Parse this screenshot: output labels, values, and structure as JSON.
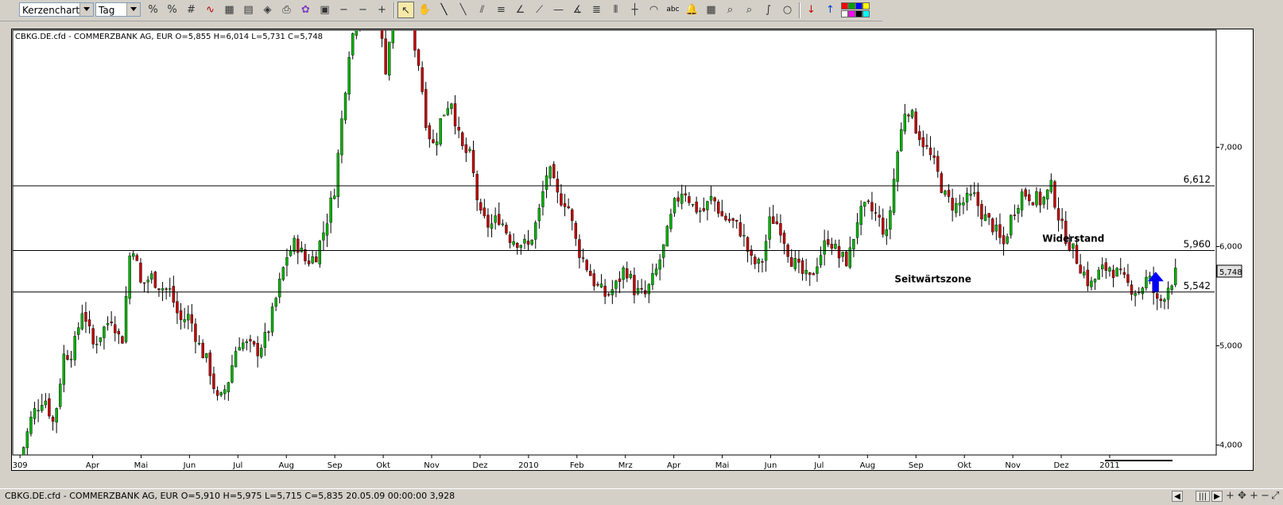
{
  "toolbar": {
    "chart_type_select": "Kerzenchart",
    "period_select": "Tag",
    "tools": [
      "percent-icon",
      "percent-alt-icon",
      "hash-icon",
      "indicator-icon",
      "calculator-sheet-icon",
      "chart-window-icon",
      "eraser-icon",
      "print-icon",
      "palette-icon",
      "bookmark-icon",
      "move-icon",
      "zoom-out-icon",
      "zoom-in-icon",
      "pointer-icon",
      "hand-icon",
      "line-icon",
      "line-angle-icon",
      "parallel-lines-icon",
      "fibonacci-icon",
      "fan-icon",
      "fan-alt-icon",
      "horizontal-line-icon",
      "fan-angle-icon",
      "color-bars-icon",
      "vertical-lines-icon",
      "crosshair-icon",
      "arc-icon",
      "text-icon",
      "alarm-bell-icon",
      "calculator-icon",
      "magnifier-icon",
      "magnifier-zoom-icon",
      "curve-icon",
      "circle-icon",
      "red-arrow-down-icon",
      "blue-arrow-up-icon",
      "color-palette-icon"
    ]
  },
  "chart_data": {
    "type": "candlestick",
    "title": "CBKG.DE.cfd - COMMERZBANK AG, EUR O=5,855 H=6,014 L=5,731 C=5,748",
    "y_axis_labels": [
      "7,000",
      "6,000",
      "5,000",
      "4,000"
    ],
    "y_ticks": [
      7.0,
      6.0,
      5.0,
      4.0
    ],
    "ylim": [
      3.9,
      8.18
    ],
    "x_ticks": [
      {
        "label": "309",
        "x": 0.5
      },
      {
        "label": "Apr",
        "x": 2
      },
      {
        "label": "Mai",
        "x": 3
      },
      {
        "label": "Jun",
        "x": 4
      },
      {
        "label": "Jul",
        "x": 5
      },
      {
        "label": "Aug",
        "x": 6
      },
      {
        "label": "Sep",
        "x": 7
      },
      {
        "label": "Okt",
        "x": 8
      },
      {
        "label": "Nov",
        "x": 9
      },
      {
        "label": "Dez",
        "x": 10
      },
      {
        "label": "2010",
        "x": 11
      },
      {
        "label": "Feb",
        "x": 12
      },
      {
        "label": "Mrz",
        "x": 13
      },
      {
        "label": "Apr",
        "x": 14
      },
      {
        "label": "Mai",
        "x": 15
      },
      {
        "label": "Jun",
        "x": 16
      },
      {
        "label": "Jul",
        "x": 17
      },
      {
        "label": "Aug",
        "x": 18
      },
      {
        "label": "Sep",
        "x": 19
      },
      {
        "label": "Okt",
        "x": 20
      },
      {
        "label": "Nov",
        "x": 21
      },
      {
        "label": "Dez",
        "x": 22
      },
      {
        "label": "2011",
        "x": 23
      }
    ],
    "x_range": [
      0.35,
      25.2
    ],
    "horizontal_lines": [
      {
        "value": 6.612,
        "label": "6,612"
      },
      {
        "value": 5.96,
        "label": "5,960"
      },
      {
        "value": 5.542,
        "label": "5,542"
      }
    ],
    "last_price_label": "5,748",
    "last_price": 5.748,
    "annotations": [
      {
        "text": "Widerstand",
        "x": 22.25,
        "y": 6.05
      },
      {
        "text": "Seitwärtszone",
        "x": 19.35,
        "y": 5.64
      }
    ],
    "arrow": {
      "color": "#0000ff",
      "x": 23.95,
      "y": 5.65
    },
    "colors": {
      "up": "#00b000",
      "down": "#c00000",
      "wick": "#000000",
      "line": "#000000"
    },
    "close_path": [
      [
        0.5,
        3.85
      ],
      [
        0.75,
        4.3
      ],
      [
        1.0,
        4.5
      ],
      [
        1.2,
        4.2
      ],
      [
        1.4,
        4.9
      ],
      [
        1.6,
        4.95
      ],
      [
        1.8,
        5.4
      ],
      [
        2.0,
        5.0
      ],
      [
        2.2,
        5.15
      ],
      [
        2.4,
        5.3
      ],
      [
        2.6,
        5.0
      ],
      [
        2.8,
        6.1
      ],
      [
        3.0,
        5.6
      ],
      [
        3.2,
        5.7
      ],
      [
        3.4,
        5.6
      ],
      [
        3.6,
        5.55
      ],
      [
        3.8,
        5.25
      ],
      [
        4.0,
        5.3
      ],
      [
        4.2,
        5.0
      ],
      [
        4.4,
        4.8
      ],
      [
        4.6,
        4.4
      ],
      [
        4.8,
        4.65
      ],
      [
        5.0,
        5.05
      ],
      [
        5.2,
        5.0
      ],
      [
        5.4,
        4.95
      ],
      [
        5.6,
        5.1
      ],
      [
        5.8,
        5.5
      ],
      [
        6.0,
        5.9
      ],
      [
        6.2,
        6.05
      ],
      [
        6.4,
        5.85
      ],
      [
        6.6,
        5.9
      ],
      [
        6.8,
        6.2
      ],
      [
        7.0,
        6.6
      ],
      [
        7.15,
        7.3
      ],
      [
        7.3,
        8.0
      ],
      [
        7.45,
        8.3
      ],
      [
        7.7,
        8.5
      ],
      [
        7.9,
        8.3
      ],
      [
        8.05,
        7.8
      ],
      [
        8.2,
        8.35
      ],
      [
        8.5,
        8.4
      ],
      [
        8.75,
        7.8
      ],
      [
        8.9,
        7.2
      ],
      [
        9.05,
        7.0
      ],
      [
        9.2,
        7.3
      ],
      [
        9.4,
        7.5
      ],
      [
        9.6,
        7.0
      ],
      [
        9.8,
        6.9
      ],
      [
        10.0,
        6.3
      ],
      [
        10.2,
        6.2
      ],
      [
        10.4,
        6.3
      ],
      [
        10.6,
        6.1
      ],
      [
        10.8,
        6.05
      ],
      [
        11.0,
        6.0
      ],
      [
        11.2,
        6.3
      ],
      [
        11.4,
        6.8
      ],
      [
        11.6,
        6.5
      ],
      [
        11.8,
        6.45
      ],
      [
        12.0,
        6.0
      ],
      [
        12.2,
        5.8
      ],
      [
        12.4,
        5.6
      ],
      [
        12.6,
        5.5
      ],
      [
        12.8,
        5.6
      ],
      [
        13.0,
        5.8
      ],
      [
        13.2,
        5.55
      ],
      [
        13.4,
        5.5
      ],
      [
        13.6,
        5.7
      ],
      [
        13.8,
        6.0
      ],
      [
        14.0,
        6.4
      ],
      [
        14.2,
        6.6
      ],
      [
        14.4,
        6.4
      ],
      [
        14.6,
        6.35
      ],
      [
        14.8,
        6.5
      ],
      [
        15.0,
        6.3
      ],
      [
        15.2,
        6.25
      ],
      [
        15.4,
        6.15
      ],
      [
        15.6,
        5.85
      ],
      [
        15.8,
        5.8
      ],
      [
        16.0,
        6.3
      ],
      [
        16.2,
        6.2
      ],
      [
        16.4,
        5.9
      ],
      [
        16.6,
        5.75
      ],
      [
        16.8,
        5.65
      ],
      [
        17.0,
        5.9
      ],
      [
        17.2,
        6.1
      ],
      [
        17.4,
        5.9
      ],
      [
        17.6,
        5.85
      ],
      [
        17.8,
        6.3
      ],
      [
        18.0,
        6.4
      ],
      [
        18.2,
        6.3
      ],
      [
        18.4,
        6.1
      ],
      [
        18.6,
        6.9
      ],
      [
        18.8,
        7.45
      ],
      [
        19.0,
        7.2
      ],
      [
        19.2,
        7.0
      ],
      [
        19.4,
        6.8
      ],
      [
        19.6,
        6.5
      ],
      [
        19.8,
        6.4
      ],
      [
        20.0,
        6.45
      ],
      [
        20.2,
        6.5
      ],
      [
        20.4,
        6.3
      ],
      [
        20.6,
        6.2
      ],
      [
        20.8,
        6.0
      ],
      [
        21.0,
        6.35
      ],
      [
        21.2,
        6.55
      ],
      [
        21.4,
        6.5
      ],
      [
        21.6,
        6.45
      ],
      [
        21.8,
        6.6
      ],
      [
        22.0,
        6.2
      ],
      [
        22.2,
        6.0
      ],
      [
        22.4,
        5.8
      ],
      [
        22.6,
        5.6
      ],
      [
        22.8,
        5.75
      ],
      [
        23.0,
        5.8
      ],
      [
        23.2,
        5.7
      ],
      [
        23.4,
        5.6
      ],
      [
        23.6,
        5.55
      ],
      [
        23.8,
        5.7
      ],
      [
        24.0,
        5.4
      ],
      [
        24.2,
        5.6
      ],
      [
        24.4,
        5.75
      ]
    ]
  },
  "status": {
    "text": "CBKG.DE.cfd - COMMERZBANK AG, EUR O=5,910 H=5,975 L=5,715 C=5,835  20.05.09 00:00:00 3,928"
  }
}
